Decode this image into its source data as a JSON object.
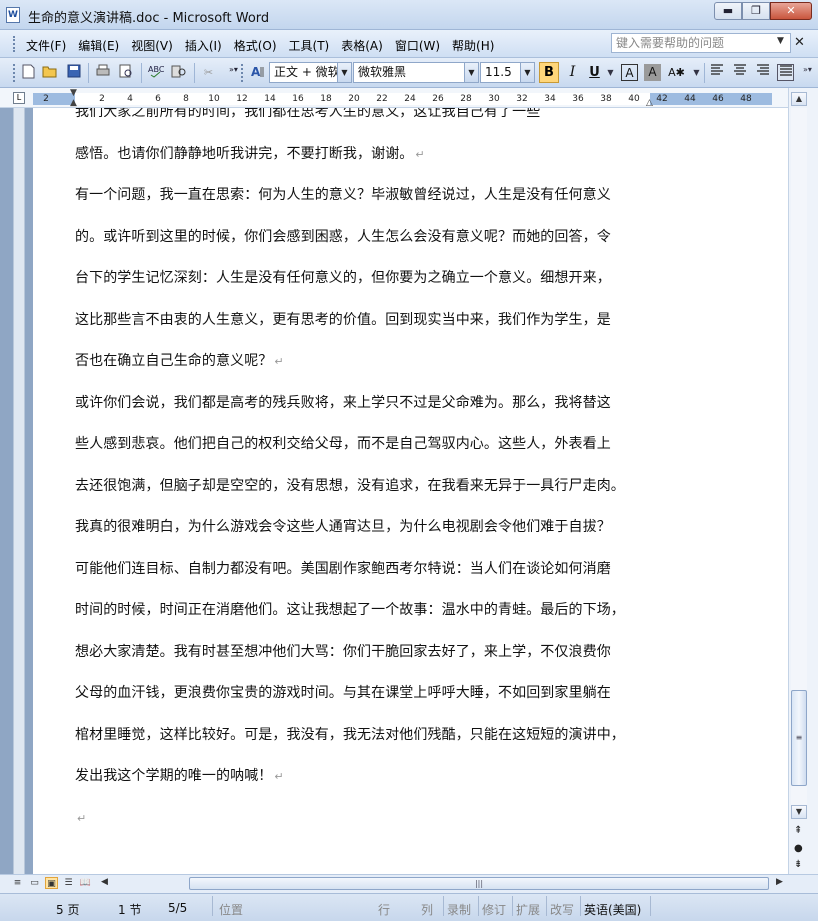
{
  "window": {
    "title": "生命的意义演讲稿.doc - Microsoft Word",
    "app_icon": "W",
    "buttons": {
      "minimize": "▬",
      "maximize": "❐",
      "close": "✕"
    }
  },
  "menubar": {
    "items": [
      "文件(F)",
      "编辑(E)",
      "视图(V)",
      "插入(I)",
      "格式(O)",
      "工具(T)",
      "表格(A)",
      "窗口(W)",
      "帮助(H)"
    ],
    "help_placeholder": "键入需要帮助的问题",
    "close": "✕"
  },
  "toolbar": {
    "style": "正文 + 微软",
    "font": "微软雅黑",
    "size": "11.5",
    "bold": "B",
    "italic": "I",
    "underline": "U",
    "char_border": "A",
    "char_shade": "A",
    "icons": [
      "new-document-icon",
      "open-icon",
      "save-icon",
      "print-icon",
      "print-preview-icon",
      "spelling-icon",
      "research-icon",
      "cut-icon",
      "styles-icon",
      "align-left-icon",
      "center-icon",
      "align-right-icon",
      "justify-icon"
    ]
  },
  "ruler": {
    "corner": "L",
    "ticks": [
      "2",
      "2",
      "4",
      "6",
      "8",
      "10",
      "12",
      "14",
      "16",
      "18",
      "20",
      "22",
      "24",
      "26",
      "28",
      "30",
      "32",
      "34",
      "36",
      "38",
      "40",
      "42",
      "44",
      "46",
      "48"
    ]
  },
  "document": {
    "lines": [
      {
        "text": "我们大家之前所有的时间，我们都在思考人生的意义，这让我自己有了一些",
        "pmark": false
      },
      {
        "text": "感悟。也请你们静静地听我讲完，不要打断我，谢谢。",
        "pmark": true
      },
      {
        "text": "有一个问题，我一直在思索：何为人生的意义？毕淑敏曾经说过，人生是没有任何意义",
        "pmark": false
      },
      {
        "text": "的。或许听到这里的时候，你们会感到困惑，人生怎么会没有意义呢？而她的回答，令",
        "pmark": false
      },
      {
        "text": "台下的学生记忆深刻：人生是没有任何意义的，但你要为之确立一个意义。细想开来，",
        "pmark": false
      },
      {
        "text": "这比那些言不由衷的人生意义，更有思考的价值。回到现实当中来，我们作为学生，是",
        "pmark": false
      },
      {
        "text": "否也在确立自己生命的意义呢？",
        "pmark": true
      },
      {
        "text": "或许你们会说，我们都是高考的残兵败将，来上学只不过是父命难为。那么，我将替这",
        "pmark": false
      },
      {
        "text": "些人感到悲哀。他们把自己的权利交给父母，而不是自己驾驭内心。这些人，外表看上",
        "pmark": false
      },
      {
        "text": "去还很饱满，但脑子却是空空的，没有思想，没有追求，在我看来无异于一具行尸走肉。",
        "pmark": false
      },
      {
        "text": "我真的很难明白，为什么游戏会令这些人通宵达旦，为什么电视剧会令他们难于自拔？",
        "pmark": false
      },
      {
        "text": "可能他们连目标、自制力都没有吧。美国剧作家鲍西考尔特说：当人们在谈论如何消磨",
        "pmark": false
      },
      {
        "text": "时间的时候，时间正在消磨他们。这让我想起了一个故事：温水中的青蛙。最后的下场，",
        "pmark": false
      },
      {
        "text": "想必大家清楚。我有时甚至想冲他们大骂：你们干脆回家去好了，来上学，不仅浪费你",
        "pmark": false
      },
      {
        "text": "父母的血汗钱，更浪费你宝贵的游戏时间。与其在课堂上呼呼大睡，不如回到家里躺在",
        "pmark": false
      },
      {
        "text": "棺材里睡觉，这样比较好。可是，我没有，我无法对他们残酷，只能在这短短的演讲中，",
        "pmark": false
      },
      {
        "text": "发出我这个学期的唯一的呐喊！",
        "pmark": true
      },
      {
        "text": "",
        "pmark": true
      }
    ],
    "pmark_char": "↵"
  },
  "statusbar": {
    "page": "5 页",
    "section": "1 节",
    "page_of": "5/5",
    "position": "位置",
    "line": "行",
    "column": "列",
    "rec": "录制",
    "trk": "修订",
    "ext": "扩展",
    "ovr": "改写",
    "language": "英语(美国)"
  },
  "colors": {
    "chrome": "#c8d9ef",
    "ruler_margin": "#9dbbe0",
    "gutter": "#8fa6c4",
    "bold_active": "#ffd67a"
  }
}
